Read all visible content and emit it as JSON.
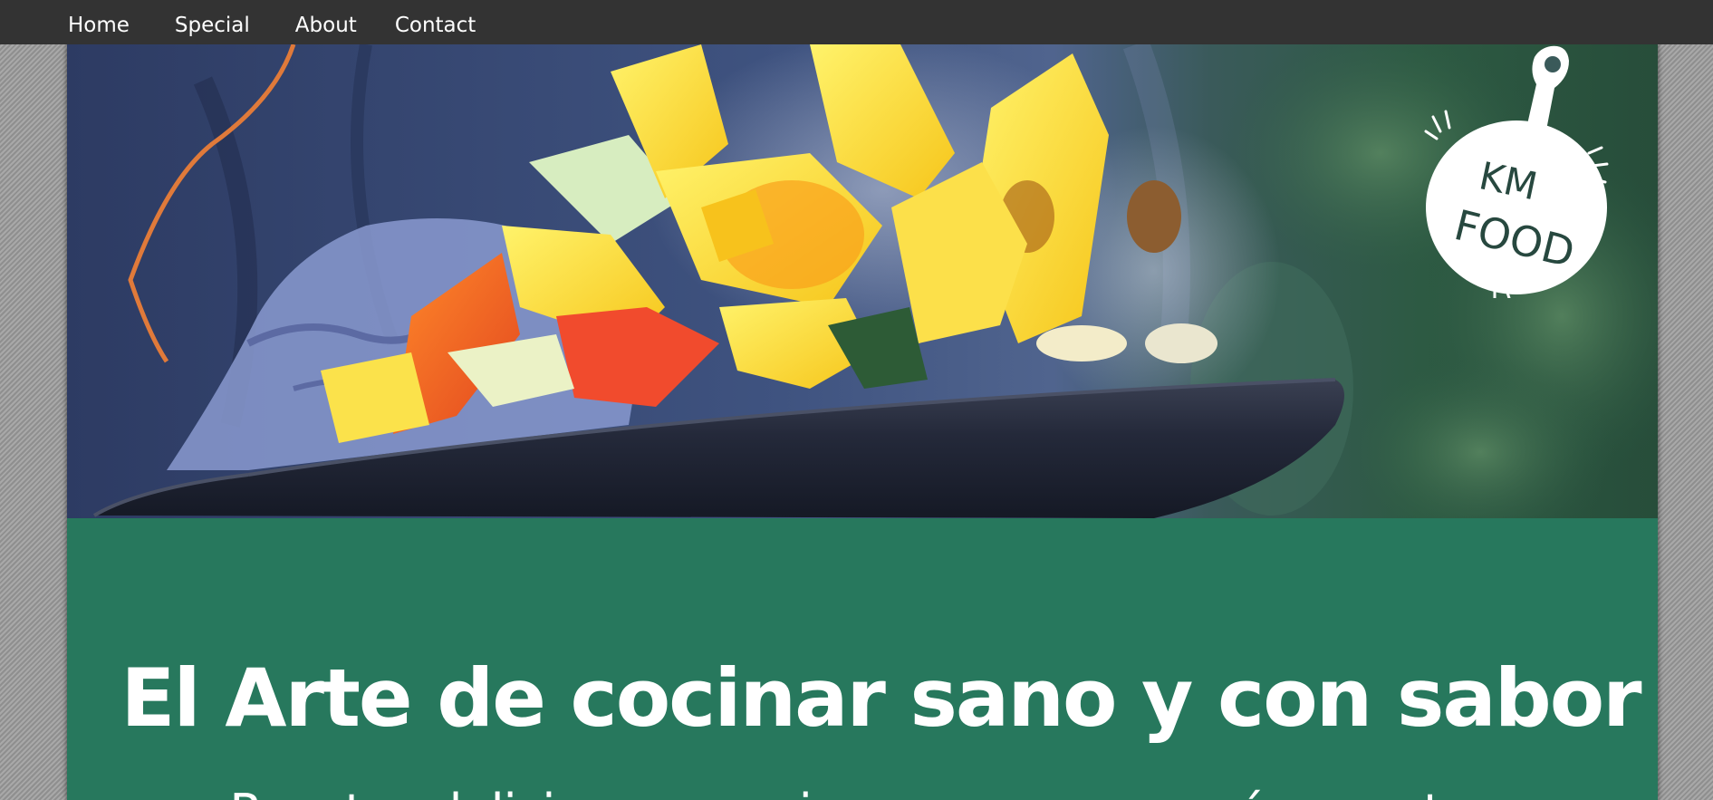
{
  "nav": {
    "items": [
      {
        "label": "Home"
      },
      {
        "label": "Special"
      },
      {
        "label": "About"
      },
      {
        "label": "Contact"
      }
    ]
  },
  "hero": {
    "image": "wok-vegetables-photo",
    "logo": {
      "icon": "frying-pan-logo",
      "line1": "KM",
      "line2": "FOOD"
    }
  },
  "banner": {
    "title": "El Arte de cocinar sano y con sabor",
    "subtitle": "Recetas deliciosas para incorporar en menús y cartas"
  },
  "colors": {
    "navbar": "#333333",
    "accent_green": "#27785d",
    "text": "#ffffff"
  }
}
